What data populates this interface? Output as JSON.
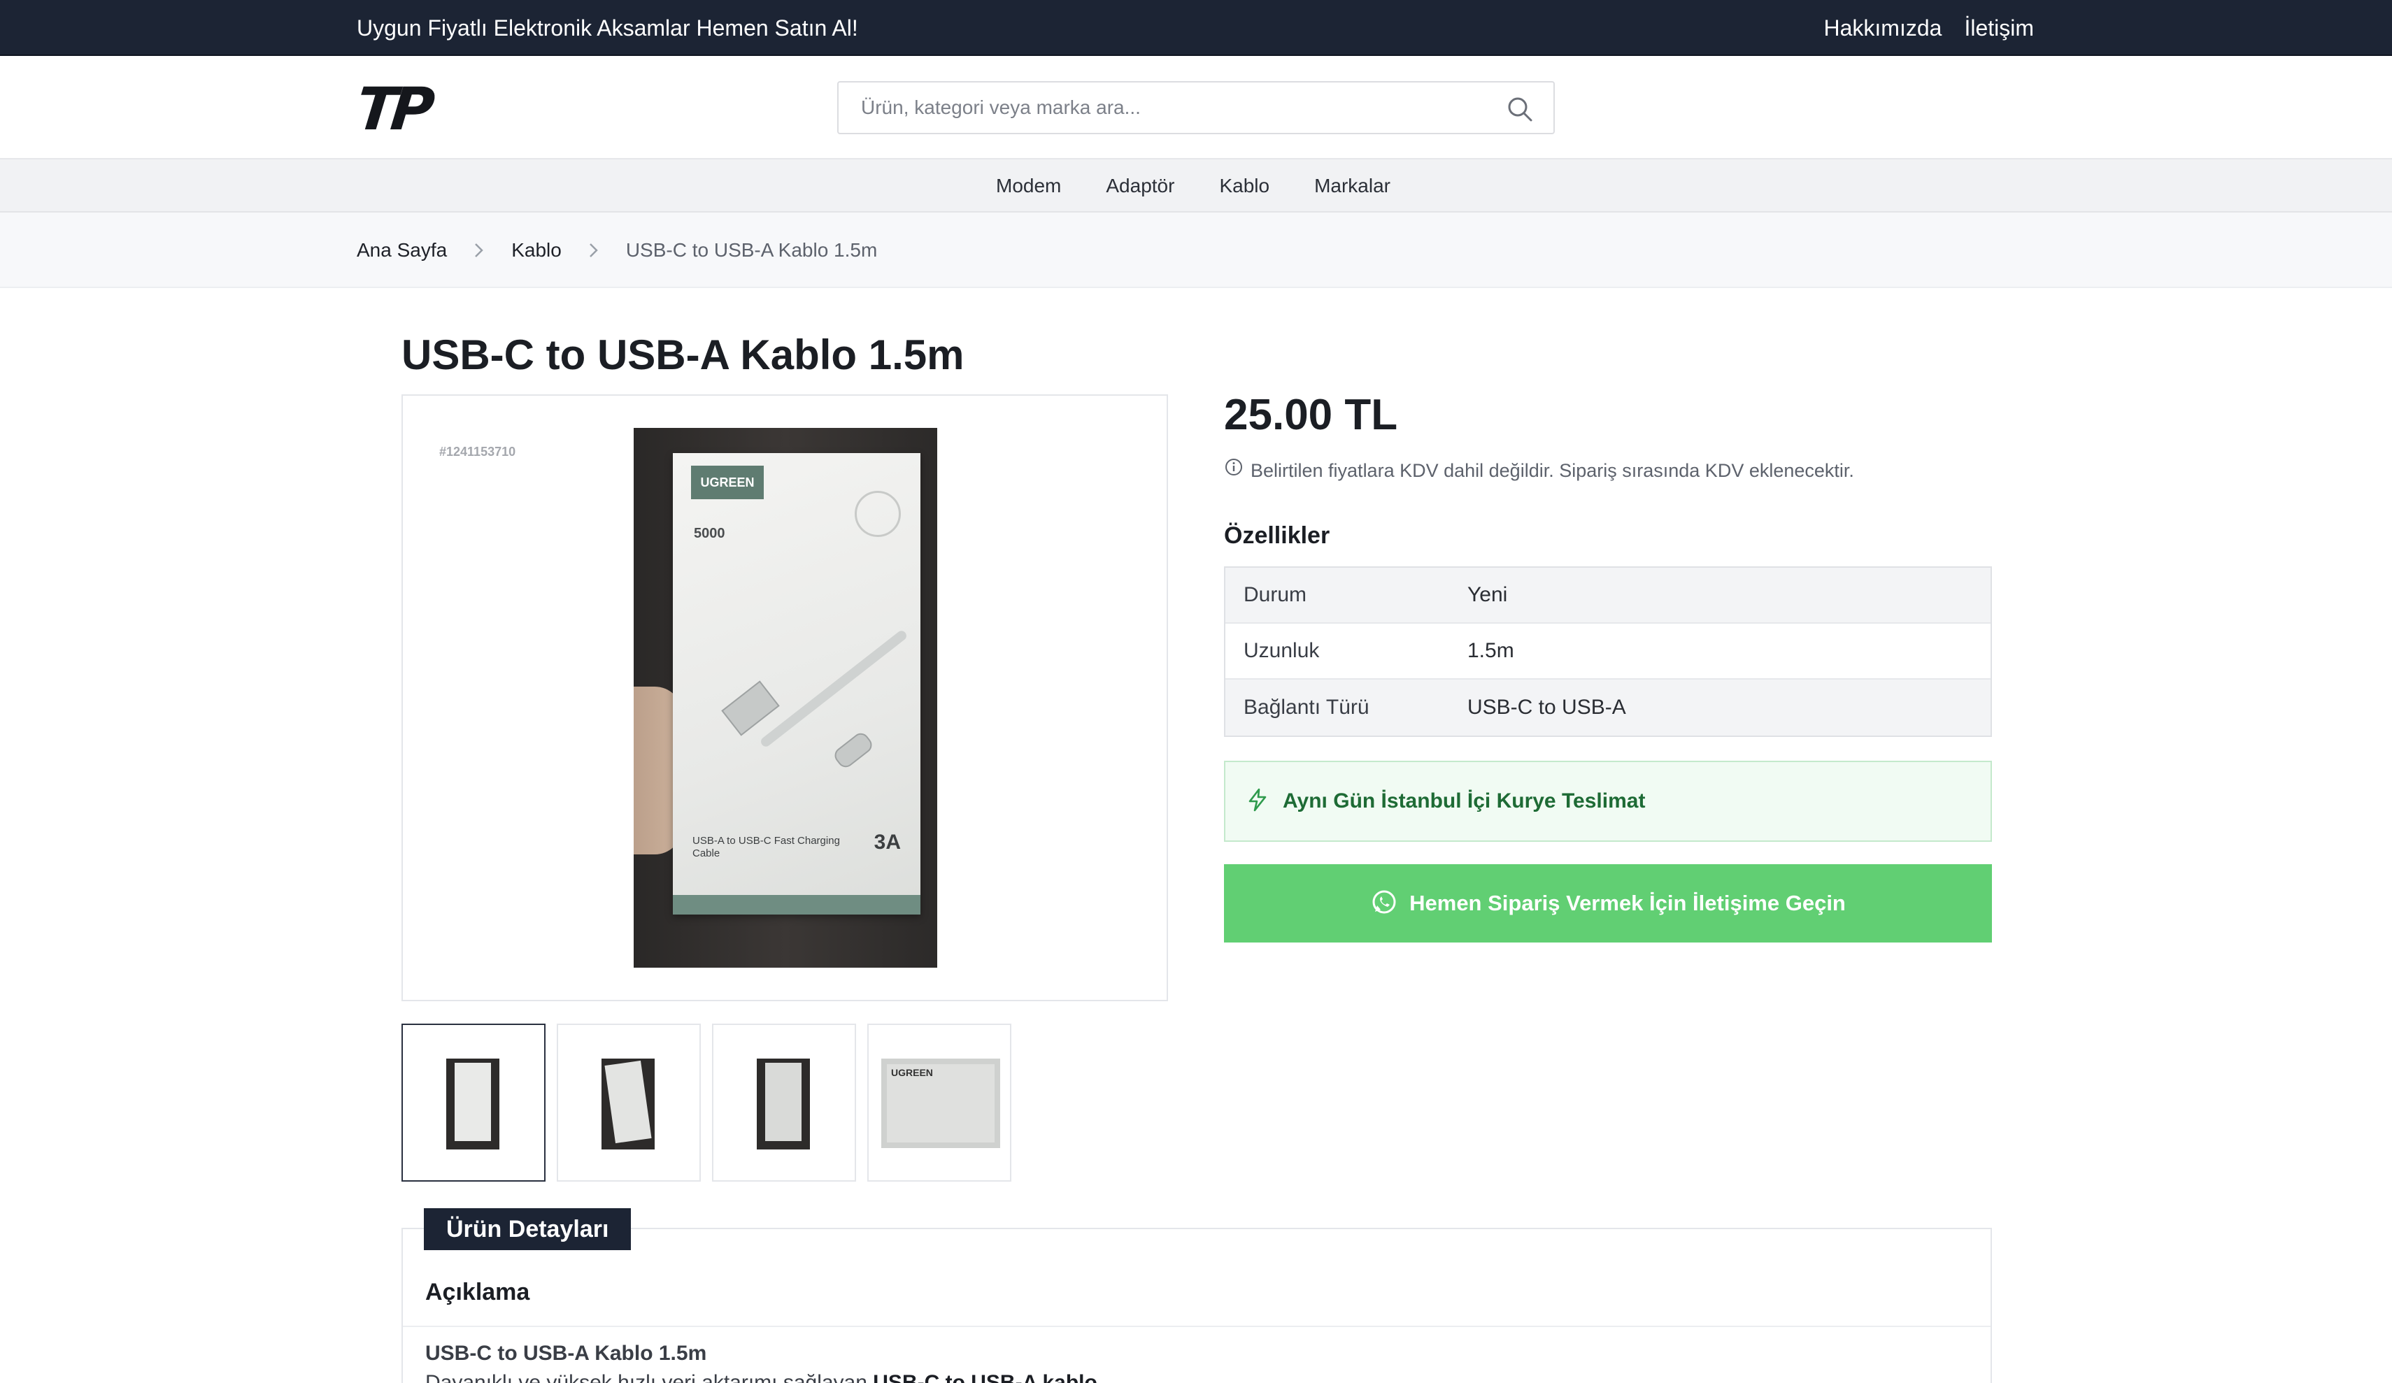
{
  "topbar": {
    "promo": "Uygun Fiyatlı Elektronik Aksamlar Hemen Satın Al!",
    "links": [
      "Hakkımızda",
      "İletişim"
    ]
  },
  "header": {
    "logo": "TP",
    "search_placeholder": "Ürün, kategori veya marka ara...",
    "search_icon": "search-icon"
  },
  "nav": {
    "items": [
      "Modem",
      "Adaptör",
      "Kablo",
      "Markalar"
    ]
  },
  "breadcrumb": {
    "items": [
      "Ana Sayfa",
      "Kablo",
      "USB-C to USB-A Kablo 1.5m"
    ]
  },
  "product": {
    "title": "USB-C to USB-A Kablo 1.5m",
    "image_code": "#1241153710",
    "box_brand": "UGREEN",
    "box_spec": "5000",
    "box_caption": "USB-A to USB-C Fast Charging Cable",
    "box_amp": "3A",
    "thumb_brand": "UGREEN",
    "thumb_count": 4,
    "active_thumb": 1,
    "price": "25.00 TL",
    "vat_note": "Belirtilen fiyatlara KDV dahil değildir. Sipariş sırasında KDV eklenecektir.",
    "features_heading": "Özellikler",
    "features": [
      {
        "key": "Durum",
        "value": "Yeni"
      },
      {
        "key": "Uzunluk",
        "value": "1.5m"
      },
      {
        "key": "Bağlantı Türü",
        "value": "USB-C to USB-A"
      }
    ],
    "delivery_text": "Aynı Gün İstanbul İçi Kurye Teslimat",
    "order_button": "Hemen Sipariş Vermek İçin İletişime Geçin"
  },
  "details": {
    "tab": "Ürün Detayları",
    "heading": "Açıklama",
    "subheading": "USB-C to USB-A Kablo 1.5m",
    "paragraph_start": "Dayanıklı ve yüksek hızlı veri aktarımı sağlayan",
    "paragraph_bold": "USB-C to USB-A kablo"
  },
  "colors": {
    "topbar_bg": "#1c2434",
    "order_button_bg": "#61cf73",
    "delivery_bg": "#f1fbf3",
    "delivery_text": "#1e6b35"
  }
}
